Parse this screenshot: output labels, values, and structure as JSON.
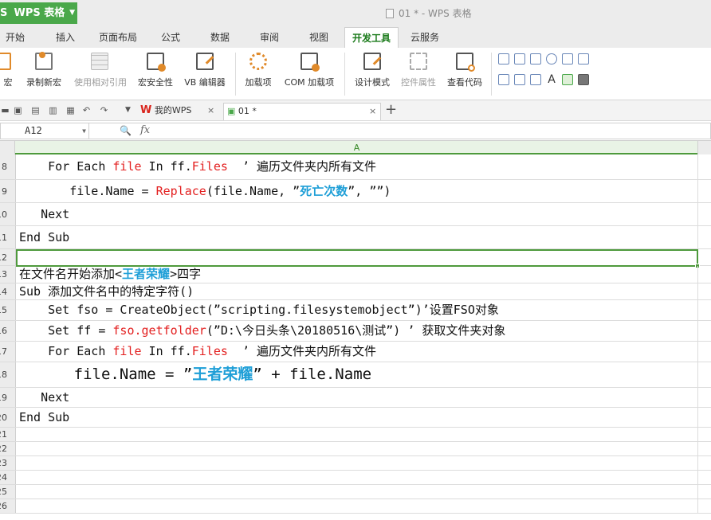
{
  "app": {
    "menu_label": "WPS 表格",
    "logo_glyph": "S",
    "window_title": "01 * - WPS 表格",
    "accent": "#4aa84a"
  },
  "tabs": [
    "开始",
    "插入",
    "页面布局",
    "公式",
    "数据",
    "审阅",
    "视图",
    "开发工具",
    "云服务"
  ],
  "active_tab": "开发工具",
  "ribbon": {
    "macro": "宏",
    "record_macro": "录制新宏",
    "relative_ref": "使用相对引用",
    "macro_security": "宏安全性",
    "vb_editor": "VB 编辑器",
    "addins": "加载项",
    "com_addins": "COM 加载项",
    "design_mode": "设计模式",
    "control_props": "控件属性",
    "view_code": "查看代码"
  },
  "quickbar": {
    "my_wps": "我的WPS",
    "doc_tab": "01 *",
    "close": "×",
    "add": "+"
  },
  "formula_bar": {
    "name_box": "A12",
    "fx": "fx",
    "content": ""
  },
  "columns": {
    "a": "A"
  },
  "rows": [
    {
      "num": "8",
      "parts": [
        [
          "    For Each ",
          ""
        ],
        [
          "file",
          "r"
        ],
        [
          " In ff.",
          ""
        ],
        [
          "Files",
          "r"
        ],
        [
          "  ’ 遍历文件夹内所有文件",
          ""
        ]
      ]
    },
    {
      "num": "9",
      "parts": [
        [
          "       file.Name = ",
          ""
        ],
        [
          "Replace",
          "r"
        ],
        [
          "(file.Name, ”",
          ""
        ],
        [
          "死亡次数",
          "b"
        ],
        [
          "”, ””)",
          ""
        ]
      ]
    },
    {
      "num": "10",
      "parts": [
        [
          "   Next",
          ""
        ]
      ]
    },
    {
      "num": "11",
      "parts": [
        [
          "End Sub",
          ""
        ]
      ]
    },
    {
      "num": "12",
      "parts": [
        [
          "",
          ""
        ]
      ]
    },
    {
      "num": "13",
      "parts": [
        [
          "在文件名开始添加<",
          ""
        ],
        [
          "王者荣耀",
          "b"
        ],
        [
          ">四字",
          ""
        ]
      ]
    },
    {
      "num": "14",
      "parts": [
        [
          "Sub 添加文件名中的特定字符()",
          ""
        ]
      ]
    },
    {
      "num": "15",
      "parts": [
        [
          "    Set fso = CreateObject(”scripting.filesystemobject”)’设置FSO对象",
          ""
        ]
      ]
    },
    {
      "num": "16",
      "parts": [
        [
          "    Set ff = ",
          ""
        ],
        [
          "fso.",
          "r"
        ],
        [
          "getfolder",
          "r"
        ],
        [
          "(”D:\\今日头条\\20180516\\测试”) ’ 获取文件夹对象",
          ""
        ]
      ]
    },
    {
      "num": "17",
      "parts": [
        [
          "    For Each ",
          ""
        ],
        [
          "file",
          "r"
        ],
        [
          " In ff.",
          ""
        ],
        [
          "Files",
          "r"
        ],
        [
          "  ’ 遍历文件夹内所有文件",
          ""
        ]
      ]
    },
    {
      "num": "18",
      "parts": [
        [
          "      file.Name = ”",
          ""
        ],
        [
          "王者荣耀",
          "b"
        ],
        [
          "” + file.Name",
          ""
        ]
      ]
    },
    {
      "num": "19",
      "parts": [
        [
          "   Next",
          ""
        ]
      ]
    },
    {
      "num": "20",
      "parts": [
        [
          "End Sub",
          ""
        ]
      ]
    },
    {
      "num": "21",
      "parts": [
        [
          "",
          ""
        ]
      ]
    },
    {
      "num": "22",
      "parts": [
        [
          "",
          ""
        ]
      ]
    },
    {
      "num": "23",
      "parts": [
        [
          "",
          ""
        ]
      ]
    },
    {
      "num": "24",
      "parts": [
        [
          "",
          ""
        ]
      ]
    },
    {
      "num": "25",
      "parts": [
        [
          "",
          ""
        ]
      ]
    },
    {
      "num": "26",
      "parts": [
        [
          "",
          ""
        ]
      ]
    }
  ],
  "colors": {
    "code_red": "#e32020",
    "code_blue": "#1f9fd7",
    "selection_green": "#4e9a3c"
  }
}
